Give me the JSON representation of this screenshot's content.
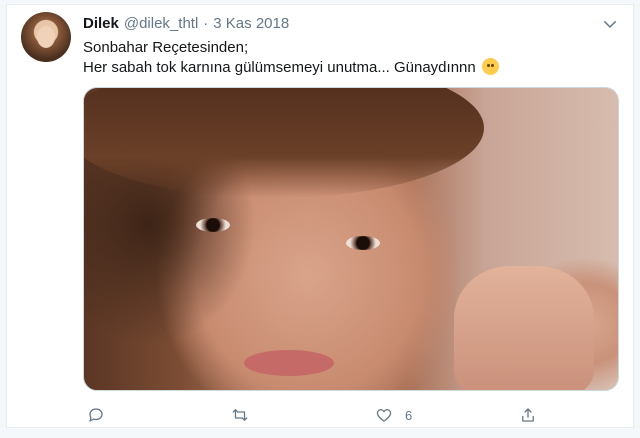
{
  "tweet": {
    "author_name": "Dilek",
    "handle": "@dilek_thtl",
    "separator": "·",
    "date": "3 Kas 2018",
    "text_line1": "Sonbahar Reçetesinden;",
    "text_line2": "Her sabah tok karnına gülümsemeyi unutma... Günaydınnn",
    "emoji": "hugging-face-emoji"
  },
  "actions": {
    "reply_icon": "reply-icon",
    "retweet_icon": "retweet-icon",
    "like_icon": "heart-icon",
    "like_count": "6",
    "share_icon": "share-icon"
  },
  "colors": {
    "text": "#14171a",
    "muted": "#657786",
    "border": "#e6ecf0",
    "background": "#f5f8fa"
  }
}
